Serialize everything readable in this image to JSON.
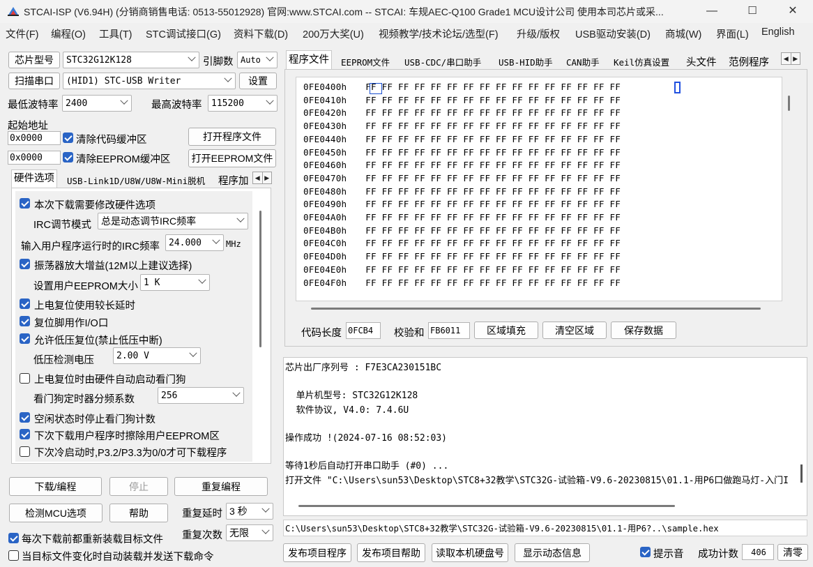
{
  "window": {
    "title": "STCAI-ISP (V6.94H) (分销商销售电话: 0513-55012928) 官网:www.STCAI.com  -- STCAI: 车规AEC-Q100 Grade1 MCU设计公司 使用本司芯片或采...",
    "minimize": "—",
    "maximize": "☐",
    "close": "✕"
  },
  "menu": [
    "文件(F)",
    "编程(O)",
    "工具(T)",
    "STC调试接口(G)",
    "资料下载(D)",
    "200万大奖(U)",
    "视频教学/技术论坛/选型(F)",
    "升级/版权",
    "USB驱动安装(D)",
    "商城(W)",
    "界面(L)",
    "English"
  ],
  "left": {
    "chip_type_button": "芯片型号",
    "chip_type_value": "STC32G12K128",
    "pins_label": "引脚数",
    "pins_value": "Auto",
    "scan_port_button": "扫描串口",
    "port_value": "(HID1) STC-USB Writer",
    "settings_button": "设置",
    "min_baud_label": "最低波特率",
    "min_baud_value": "2400",
    "max_baud_label": "最高波特率",
    "max_baud_value": "115200",
    "start_addr_label": "起始地址",
    "code_addr": "0x0000",
    "clear_code_label": "清除代码缓冲区",
    "open_program_button": "打开程序文件",
    "eeprom_addr": "0x0000",
    "clear_eeprom_label": "清除EEPROM缓冲区",
    "open_eeprom_button": "打开EEPROM文件",
    "tabs": [
      "硬件选项",
      "USB-Link1D/U8W/U8W-Mini脱机",
      "程序加"
    ],
    "options": {
      "modify_hw": "本次下载需要修改硬件选项",
      "irc_mode_label": "IRC调节模式",
      "irc_mode_value": "总是动态调节IRC频率",
      "irc_freq_label": "输入用户程序运行时的IRC频率",
      "irc_freq_value": "24.000",
      "irc_freq_unit": "MHz",
      "osc_gain": "振荡器放大增益(12M以上建议选择)",
      "eeprom_size_label": "设置用户EEPROM大小",
      "eeprom_size_value": "1    K",
      "long_delay": "上电复位使用较长延时",
      "reset_io": "复位脚用作I/O口",
      "lvr": "允许低压复位(禁止低压中断)",
      "lv_label": "低压检测电压",
      "lv_value": "2.00 V",
      "wdt_auto": "上电复位时由硬件自动启动看门狗",
      "wdt_div_label": "看门狗定时器分频系数",
      "wdt_div_value": "256",
      "idle_wdt": "空闲状态时停止看门狗计数",
      "erase_eeprom": "下次下载用户程序时擦除用户EEPROM区",
      "cold_boot": "下次冷启动时,P3.2/P3.3为0/0才可下载程序"
    },
    "download_button": "下载/编程",
    "stop_button": "停止",
    "reprogram_button": "重复编程",
    "check_mcu_button": "检测MCU选项",
    "help_button": "帮助",
    "repeat_delay_label": "重复延时",
    "repeat_delay_value": "3 秒",
    "repeat_count_label": "重复次数",
    "repeat_count_value": "无限",
    "reload_label": "每次下载前都重新装载目标文件",
    "auto_reload_label": "当目标文件变化时自动装载并发送下载命令"
  },
  "right": {
    "tabs": [
      "程序文件",
      "EEPROM文件",
      "USB-CDC/串口助手",
      "USB-HID助手",
      "CAN助手",
      "Keil仿真设置",
      "头文件",
      "范例程序"
    ],
    "hex": {
      "addresses": [
        "0FE0400h",
        "0FE0410h",
        "0FE0420h",
        "0FE0430h",
        "0FE0440h",
        "0FE0450h",
        "0FE0460h",
        "0FE0470h",
        "0FE0480h",
        "0FE0490h",
        "0FE04A0h",
        "0FE04B0h",
        "0FE04C0h",
        "0FE04D0h",
        "0FE04E0h",
        "0FE04F0h"
      ],
      "bytes": "FF FF FF FF FF FF FF FF FF FF FF FF FF FF FF FF"
    },
    "code_length_label": "代码长度",
    "code_length_value": "0FCB4",
    "checksum_label": "校验和",
    "checksum_value": "FB6011",
    "fill_button": "区域填充",
    "clear_button": "清空区域",
    "save_button": "保存数据",
    "log": [
      "芯片出厂序列号 : F7E3CA230151BC",
      "",
      "  单片机型号: STC32G12K128",
      "  软件协议, V4.0: 7.4.6U",
      "",
      "操作成功 !(2024-07-16 08:52:03)",
      "",
      "等待1秒后自动打开串口助手 (#0) ...",
      "打开文件 \"C:\\Users\\sun53\\Desktop\\STC8+32教学\\STC32G-试验箱-V9.6-20230815\\01.1-用P6口做跑马灯-入门I"
    ],
    "path": "C:\\Users\\sun53\\Desktop\\STC8+32教学\\STC32G-试验箱-V9.6-20230815\\01.1-用P6?..\\sample.hex",
    "publish_button": "发布项目程序",
    "publish_help_button": "发布项目帮助",
    "read_disk_button": "读取本机硬盘号",
    "show_dynamic_button": "显示动态信息",
    "beep_label": "提示音",
    "success_label": "成功计数",
    "success_value": "406",
    "reset_button": "清零"
  }
}
